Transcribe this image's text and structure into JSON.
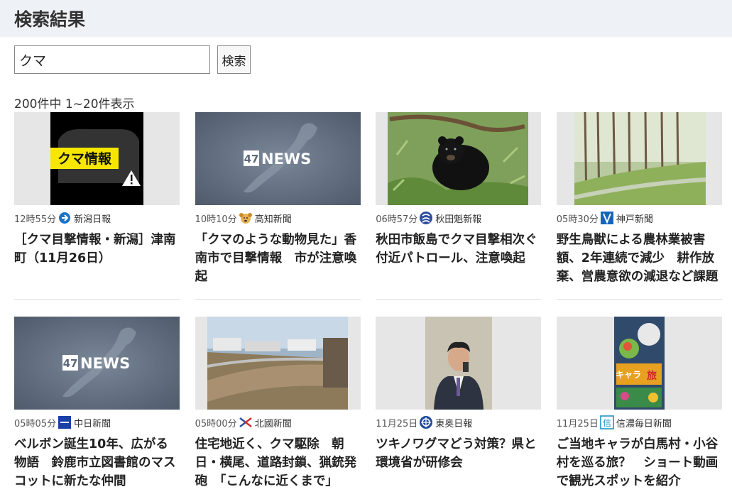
{
  "page": {
    "title": "検索結果"
  },
  "search": {
    "query": "クマ",
    "button_label": "検索"
  },
  "results": {
    "summary": "200件中 1~20件表示",
    "items": [
      {
        "time": "12時55分",
        "source": "新潟日報",
        "logo": "niigata-nippo-logo",
        "logo_color": "#1a73c8",
        "title": "［クマ目撃情報・新潟］津南町（11月26日）",
        "thumb": "bear-alert"
      },
      {
        "time": "10時10分",
        "source": "高知新聞",
        "logo": "kochi-shimbun-logo",
        "logo_color": "#d9a23a",
        "title": "「クマのような動物見た」香南市で目撃情報　市が注意喚起",
        "thumb": "47news"
      },
      {
        "time": "06時57分",
        "source": "秋田魁新報",
        "logo": "akita-sakigake-logo",
        "logo_color": "#2f4f9f",
        "title": "秋田市飯島でクマ目撃相次ぐ　付近パトロール、注意喚起",
        "thumb": "bear-photo"
      },
      {
        "time": "05時30分",
        "source": "神戸新聞",
        "logo": "kobe-shimbun-logo",
        "logo_color": "#1665b8",
        "title": "野生鳥獣による農林業被害額、2年連続で減少　耕作放棄、営農意欲の減退など課題",
        "thumb": "forest-fence"
      },
      {
        "time": "05時05分",
        "source": "中日新聞",
        "logo": "chunichi-shimbun-logo",
        "logo_color": "#1b3fa8",
        "title": "ベルボン誕生10年、広がる物語　鈴鹿市立図書館のマスコットに新たな仲間",
        "thumb": "47news"
      },
      {
        "time": "05時00分",
        "source": "北國新聞",
        "logo": "hokkoku-shimbun-logo",
        "logo_color": "#2a4fa0",
        "title": "住宅地近く、クマ駆除　朝日・横尾、道路封鎖、猟銃発砲　「こんなに近くまで」",
        "thumb": "residential"
      },
      {
        "time": "11月25日",
        "source": "東奥日報",
        "logo": "toonippo-logo",
        "logo_color": "#234a9a",
        "title": "ツキノワグマどう対策？県と環境省が研修会",
        "thumb": "speaker"
      },
      {
        "time": "11月25日",
        "source": "信濃毎日新聞",
        "logo": "shinmai-logo",
        "logo_color": "#1e96c8",
        "title": "ご当地キャラが白馬村・小谷村を巡る旅？　ショート動画で観光スポットを紹介",
        "thumb": "mascot-poster"
      }
    ]
  },
  "thumbnails": {
    "bear_alert_label": "クマ情報",
    "news_brand_number": "47",
    "news_brand_word": "NEWS",
    "mascot_title_a": "キャラ",
    "mascot_title_b": "旅"
  }
}
